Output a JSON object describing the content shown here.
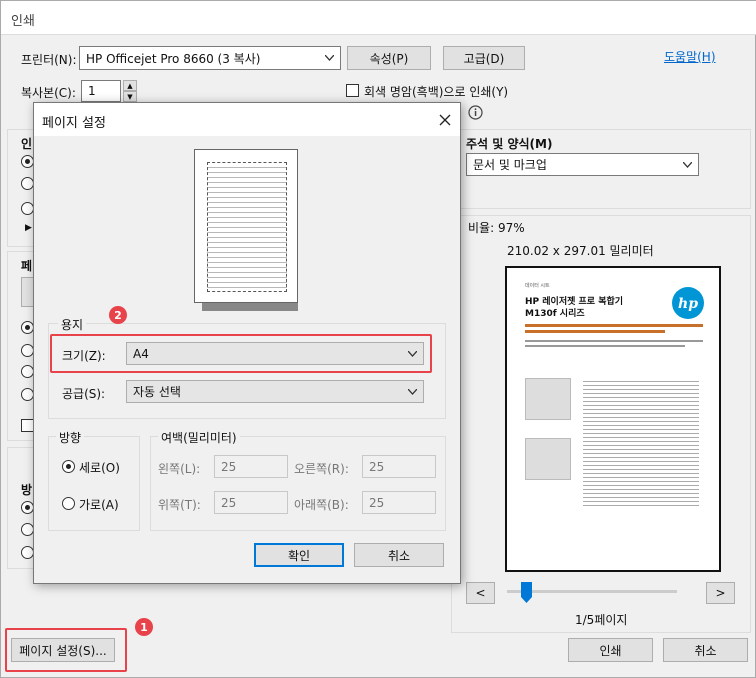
{
  "window": {
    "title": "인쇄"
  },
  "printer": {
    "label": "프린터(N):",
    "selected": "HP Officejet Pro 8660 (3 복사)",
    "properties_button": "속성(P)",
    "advanced_button": "고급(D)",
    "help_link": "도움말(H)"
  },
  "copies": {
    "label": "복사본(C):",
    "value": "1"
  },
  "grayscale": {
    "label": "회색 명암(흑백)으로 인쇄(Y)"
  },
  "comments": {
    "heading": "주석 및 양식(M)",
    "selected": "문서 및 마크업"
  },
  "scale": {
    "label": "비율: 97%",
    "size": "210.02 x 297.01 밀리미터"
  },
  "preview": {
    "page_indicator": "1/5페이지",
    "prev": "<",
    "next": ">",
    "doc_subtitle": "데이터 시트",
    "doc_title_line1": "HP 레이저젯 프로 복합기",
    "doc_title_line2": "M130f 시리즈"
  },
  "bottom": {
    "page_setup_button": "페이지 설정(S)...",
    "print_button": "인쇄",
    "cancel_button": "취소"
  },
  "left_partial": {
    "section1": "인",
    "section2": "페",
    "section3": "방"
  },
  "dialog": {
    "title": "페이지 설정",
    "paper_group": "용지",
    "size_label": "크기(Z):",
    "size_value": "A4",
    "source_label": "공급(S):",
    "source_value": "자동 선택",
    "orientation_group": "방향",
    "portrait": "세로(O)",
    "landscape": "가로(A)",
    "margins_group": "여백(밀리미터)",
    "left_label": "왼쪽(L):",
    "left_value": "25",
    "right_label": "오른쪽(R):",
    "right_value": "25",
    "top_label": "위쪽(T):",
    "top_value": "25",
    "bottom_label": "아래쪽(B):",
    "bottom_value": "25",
    "ok": "확인",
    "cancel": "취소"
  },
  "badges": {
    "one": "1",
    "two": "2"
  },
  "colors": {
    "accent": "#0078d7",
    "highlight": "#e8434a",
    "hp_blue": "#0096d6"
  }
}
